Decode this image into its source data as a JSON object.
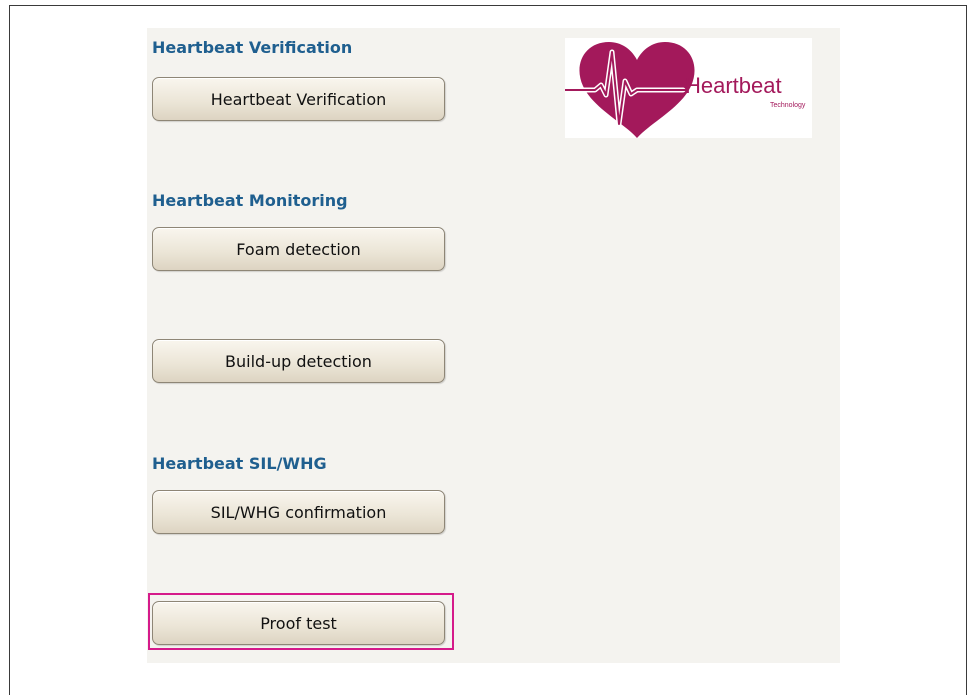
{
  "sections": [
    {
      "title": "Heartbeat Verification",
      "buttons": [
        "Heartbeat Verification"
      ]
    },
    {
      "title": "Heartbeat Monitoring",
      "buttons": [
        "Foam detection",
        "Build-up detection"
      ]
    },
    {
      "title": "Heartbeat SIL/WHG",
      "buttons": [
        "SIL/WHG confirmation",
        "Proof test"
      ]
    }
  ],
  "logo": {
    "word": "Heartbeat",
    "subtitle": "Technology",
    "icon": "heart-pulse-icon",
    "color": "#a3195b"
  },
  "highlight_color": "#d51a8a",
  "highlighted_button": "Proof test"
}
